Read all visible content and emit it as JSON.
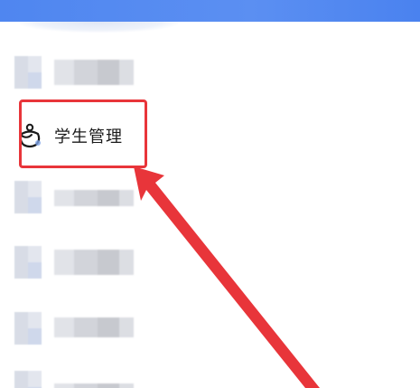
{
  "menu": {
    "selected_item": {
      "label": "学生管理",
      "icon": "student-icon"
    }
  },
  "colors": {
    "top_bar": "#4f86f0",
    "annotation_red": "#e8353a"
  }
}
